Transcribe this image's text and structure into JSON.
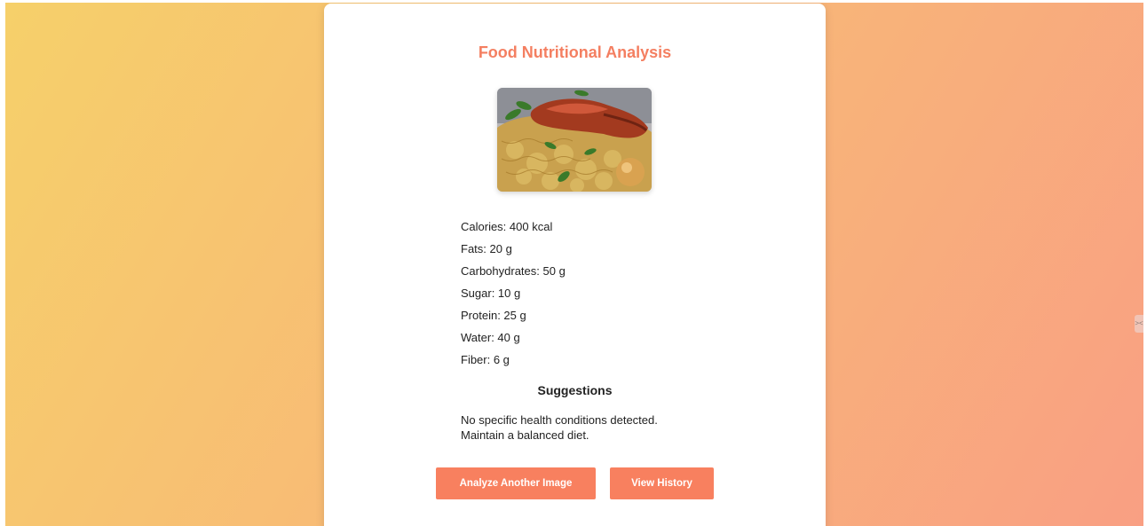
{
  "page": {
    "title": "Food Nutritional Analysis"
  },
  "image": {
    "alt": "Food Image"
  },
  "nutrients": [
    {
      "label": "Calories: 400 kcal"
    },
    {
      "label": "Fats: 20 g"
    },
    {
      "label": "Carbohydrates: 50 g"
    },
    {
      "label": "Sugar: 10 g"
    },
    {
      "label": "Protein: 25 g"
    },
    {
      "label": "Water: 40 g"
    },
    {
      "label": "Fiber: 6 g"
    }
  ],
  "suggestions": {
    "heading": "Suggestions",
    "line1": "No specific health conditions detected.",
    "line2": "Maintain a balanced diet."
  },
  "buttons": {
    "analyze_label": "Analyze Another Image",
    "history_label": "View History"
  },
  "edge_tab": {
    "glyph": "><"
  },
  "colors": {
    "accent": "#f47f61",
    "button": "#f8805f",
    "gradient_start": "#f6d06a",
    "gradient_end": "#f99f83"
  }
}
